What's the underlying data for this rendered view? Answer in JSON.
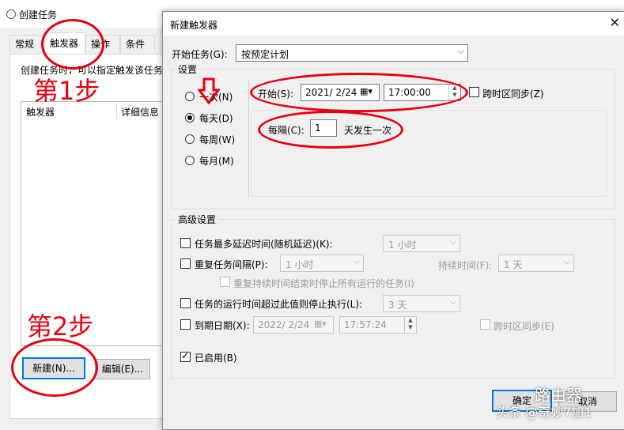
{
  "background_window": {
    "title": "创建任务",
    "tabs": [
      "常规",
      "触发器",
      "操作",
      "条件"
    ],
    "description": "创建任务时，可以指定触发该任务",
    "table_headers": [
      "触发器",
      "详细信息"
    ],
    "buttons": {
      "new": "新建(N)...",
      "edit": "编辑(E)..."
    }
  },
  "dialog": {
    "title": "新建触发器",
    "begin_task_label": "开始任务(G):",
    "begin_task_value": "按预定计划",
    "settings_group": "设置",
    "schedule_options": [
      "一次(N)",
      "每天(D)",
      "每周(W)",
      "每月(M)"
    ],
    "schedule_selected": "每天(D)",
    "start_label": "开始(S):",
    "start_date": "2021/ 2/24",
    "start_time": "17:00:00",
    "sync_tz_label": "跨时区同步(Z)",
    "recur_label": "每隔(C):",
    "recur_value": "1",
    "recur_suffix": "天发生一次",
    "advanced_group": "高级设置",
    "delay_label": "任务最多延迟时间(随机延迟)(K):",
    "delay_value": "1 小时",
    "repeat_label": "重复任务间隔(P):",
    "repeat_value": "1 小时",
    "duration_label": "持续时间(F):",
    "duration_value": "1 天",
    "stop_all_label": "重复持续时间结束时停止所有运行的任务(I)",
    "stop_if_label": "任务的运行时间超过此值则停止执行(L):",
    "stop_if_value": "3 天",
    "expire_label": "到期日期(X):",
    "expire_date": "2022/ 2/24",
    "expire_time": "17:57:24",
    "expire_sync_label": "跨时区同步(E)",
    "enabled_label": "已启用(B)",
    "ok_button": "确定",
    "cancel_button": "取消",
    "close_glyph": "✕"
  },
  "annotations": {
    "step1": "第1步",
    "step2": "第2步",
    "color": "#e60012"
  },
  "watermark": {
    "site": "路由器",
    "author": "头条 @奇妙7加1"
  },
  "colors": {
    "accent": "#0078d7",
    "annotation": "#e60012"
  }
}
